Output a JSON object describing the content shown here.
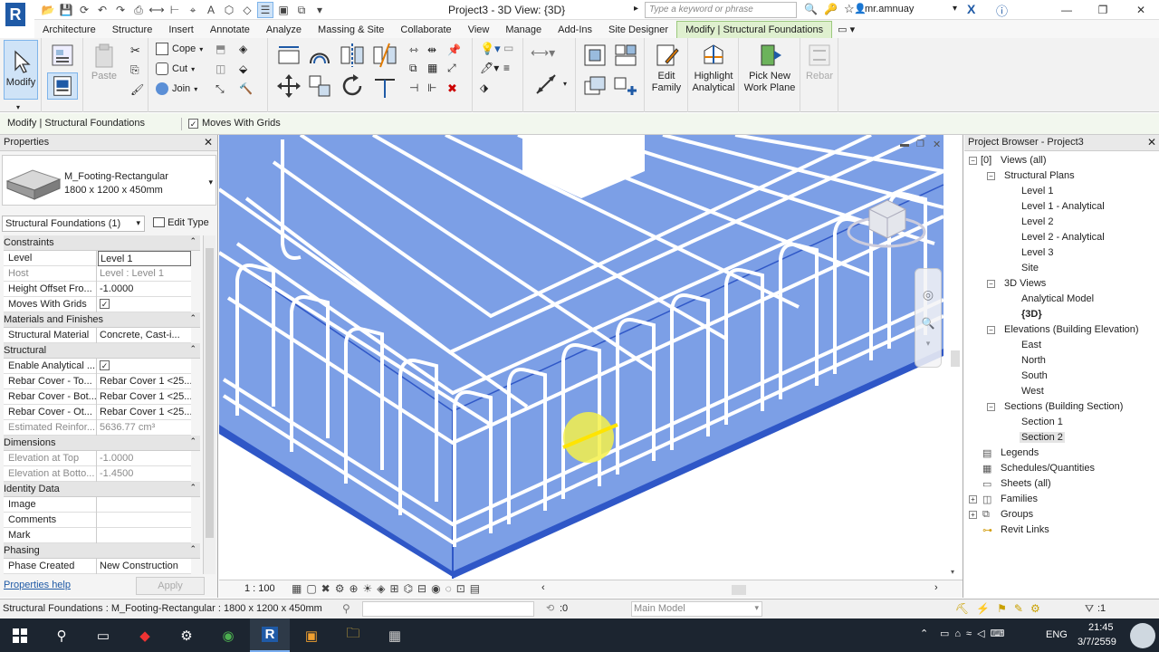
{
  "title": "Project3 - 3D View: {3D}",
  "search": {
    "placeholder": "Type a keyword or phrase"
  },
  "user": "mr.amnuay",
  "tabs": [
    "Architecture",
    "Structure",
    "Insert",
    "Annotate",
    "Analyze",
    "Massing & Site",
    "Collaborate",
    "View",
    "Manage",
    "Add-Ins",
    "Site Designer",
    "Modify | Structural Foundations"
  ],
  "ribbon": {
    "modify": "Modify",
    "paste": "Paste",
    "cope": "Cope",
    "cut": "Cut",
    "join": "Join",
    "edit_family": [
      "Edit",
      "Family"
    ],
    "highlight_analytical": [
      "Highlight",
      "Analytical"
    ],
    "pick_work_plane": [
      "Pick New",
      "Work Plane"
    ],
    "rebar": "Rebar"
  },
  "context": {
    "label": "Modify | Structural Foundations",
    "moves_with_grids": "Moves With Grids"
  },
  "properties": {
    "header": "Properties",
    "type_name": "M_Footing-Rectangular",
    "type_size": "1800 x 1200 x 450mm",
    "selector": "Structural Foundations (1)",
    "edit_type": "Edit Type",
    "sections": {
      "constraints": "Constraints",
      "materials": "Materials and Finishes",
      "structural": "Structural",
      "dimensions": "Dimensions",
      "identity": "Identity Data",
      "phasing": "Phasing"
    },
    "rows": {
      "level": {
        "k": "Level",
        "v": "Level 1"
      },
      "host": {
        "k": "Host",
        "v": "Level : Level 1"
      },
      "height_offset": {
        "k": "Height Offset Fro...",
        "v": "-1.0000"
      },
      "moves_with_grids": {
        "k": "Moves With Grids"
      },
      "structural_material": {
        "k": "Structural Material",
        "v": "Concrete, Cast-i..."
      },
      "enable_analytical": {
        "k": "Enable Analytical ..."
      },
      "rebar_top": {
        "k": "Rebar Cover - To...",
        "v": "Rebar Cover 1 <25..."
      },
      "rebar_bot": {
        "k": "Rebar Cover - Bot...",
        "v": "Rebar Cover 1 <25..."
      },
      "rebar_oth": {
        "k": "Rebar Cover - Ot...",
        "v": "Rebar Cover 1 <25..."
      },
      "est_reinf": {
        "k": "Estimated Reinfor...",
        "v": "5636.77 cm³"
      },
      "elev_top": {
        "k": "Elevation at Top",
        "v": "-1.0000"
      },
      "elev_bot": {
        "k": "Elevation at Botto...",
        "v": "-1.4500"
      },
      "image": {
        "k": "Image",
        "v": ""
      },
      "comments": {
        "k": "Comments",
        "v": ""
      },
      "mark": {
        "k": "Mark",
        "v": ""
      },
      "phase_created": {
        "k": "Phase Created",
        "v": "New Construction"
      }
    },
    "help": "Properties help",
    "apply": "Apply"
  },
  "view": {
    "scale": "1 : 100"
  },
  "browser": {
    "header": "Project Browser - Project3",
    "views_all": "Views (all)",
    "structural_plans": "Structural Plans",
    "plans": [
      "Level 1",
      "Level 1 - Analytical",
      "Level 2",
      "Level 2 - Analytical",
      "Level 3",
      "Site"
    ],
    "views_3d": "3D Views",
    "v3d": [
      "Analytical Model",
      "{3D}"
    ],
    "elevations": "Elevations (Building Elevation)",
    "elev": [
      "East",
      "North",
      "South",
      "West"
    ],
    "sections": "Sections (Building Section)",
    "secs": [
      "Section 1",
      "Section 2"
    ],
    "legends": "Legends",
    "schedules": "Schedules/Quantities",
    "sheets": "Sheets (all)",
    "families": "Families",
    "groups": "Groups",
    "revit_links": "Revit Links"
  },
  "status": {
    "text": "Structural Foundations : M_Footing-Rectangular : 1800 x 1200 x 450mm",
    "count": ":0",
    "model": "Main Model",
    "filter": ":1"
  },
  "taskbar": {
    "time": "21:45",
    "date": "3/7/2559",
    "lang": "ENG"
  },
  "colors": {
    "accent": "#1f5aa6",
    "slab": "#7c9fe6",
    "context_tab": "#dff0cf"
  }
}
